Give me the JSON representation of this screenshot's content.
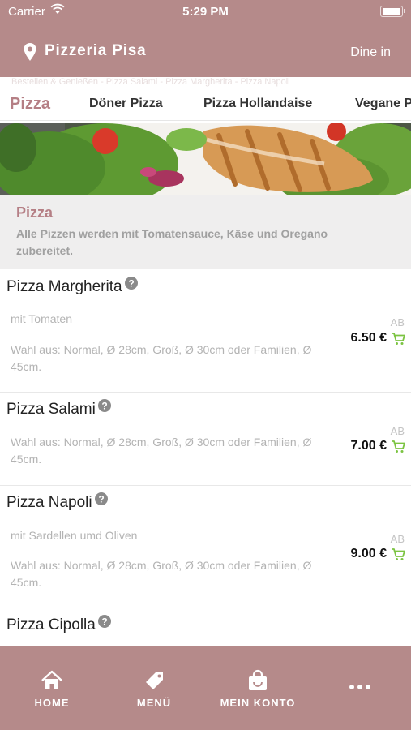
{
  "status_bar": {
    "carrier": "Carrier",
    "time": "5:29 PM"
  },
  "header": {
    "title": "Pizzeria Pisa",
    "dine_in": "Dine in"
  },
  "faded_line": "Bestellen & Genießen - Pizza Salami - Pizza Margherita - Pizza Napoli",
  "tabs": [
    {
      "label": "Pizza"
    },
    {
      "label": "Döner Pizza"
    },
    {
      "label": "Pizza Hollandaise"
    },
    {
      "label": "Vegane Pizza"
    }
  ],
  "category": {
    "title": "Pizza",
    "description": "Alle Pizzen werden mit Tomatensauce, Käse und Oregano zubereitet."
  },
  "items": [
    {
      "name": "Pizza Margherita",
      "desc1": "mit Tomaten",
      "desc2": "Wahl aus: Normal, Ø 28cm, Groß, Ø 30cm oder Familien, Ø 45cm.",
      "ab": "AB",
      "price": "6.50 €"
    },
    {
      "name": "Pizza Salami",
      "desc1": "",
      "desc2": "Wahl aus: Normal, Ø 28cm, Groß, Ø 30cm oder Familien, Ø 45cm.",
      "ab": "AB",
      "price": "7.00 €"
    },
    {
      "name": "Pizza Napoli",
      "desc1": "mit Sardellen umd Oliven",
      "desc2": "Wahl aus: Normal, Ø 28cm, Groß, Ø 30cm oder Familien, Ø 45cm.",
      "ab": "AB",
      "price": "9.00 €"
    },
    {
      "name": "Pizza Cipolla",
      "desc1": "",
      "desc2": "",
      "ab": "",
      "price": ""
    }
  ],
  "bottom_nav": [
    {
      "label": "HOME",
      "icon": "home-icon"
    },
    {
      "label": "MENÜ",
      "icon": "tag-icon"
    },
    {
      "label": "MEIN KONTO",
      "icon": "shopping-bag-icon"
    },
    {
      "label": "",
      "icon": "more-icon"
    }
  ],
  "colors": {
    "brand": "#b58a8a",
    "accent": "#b57f85",
    "cart": "#7cc442"
  }
}
